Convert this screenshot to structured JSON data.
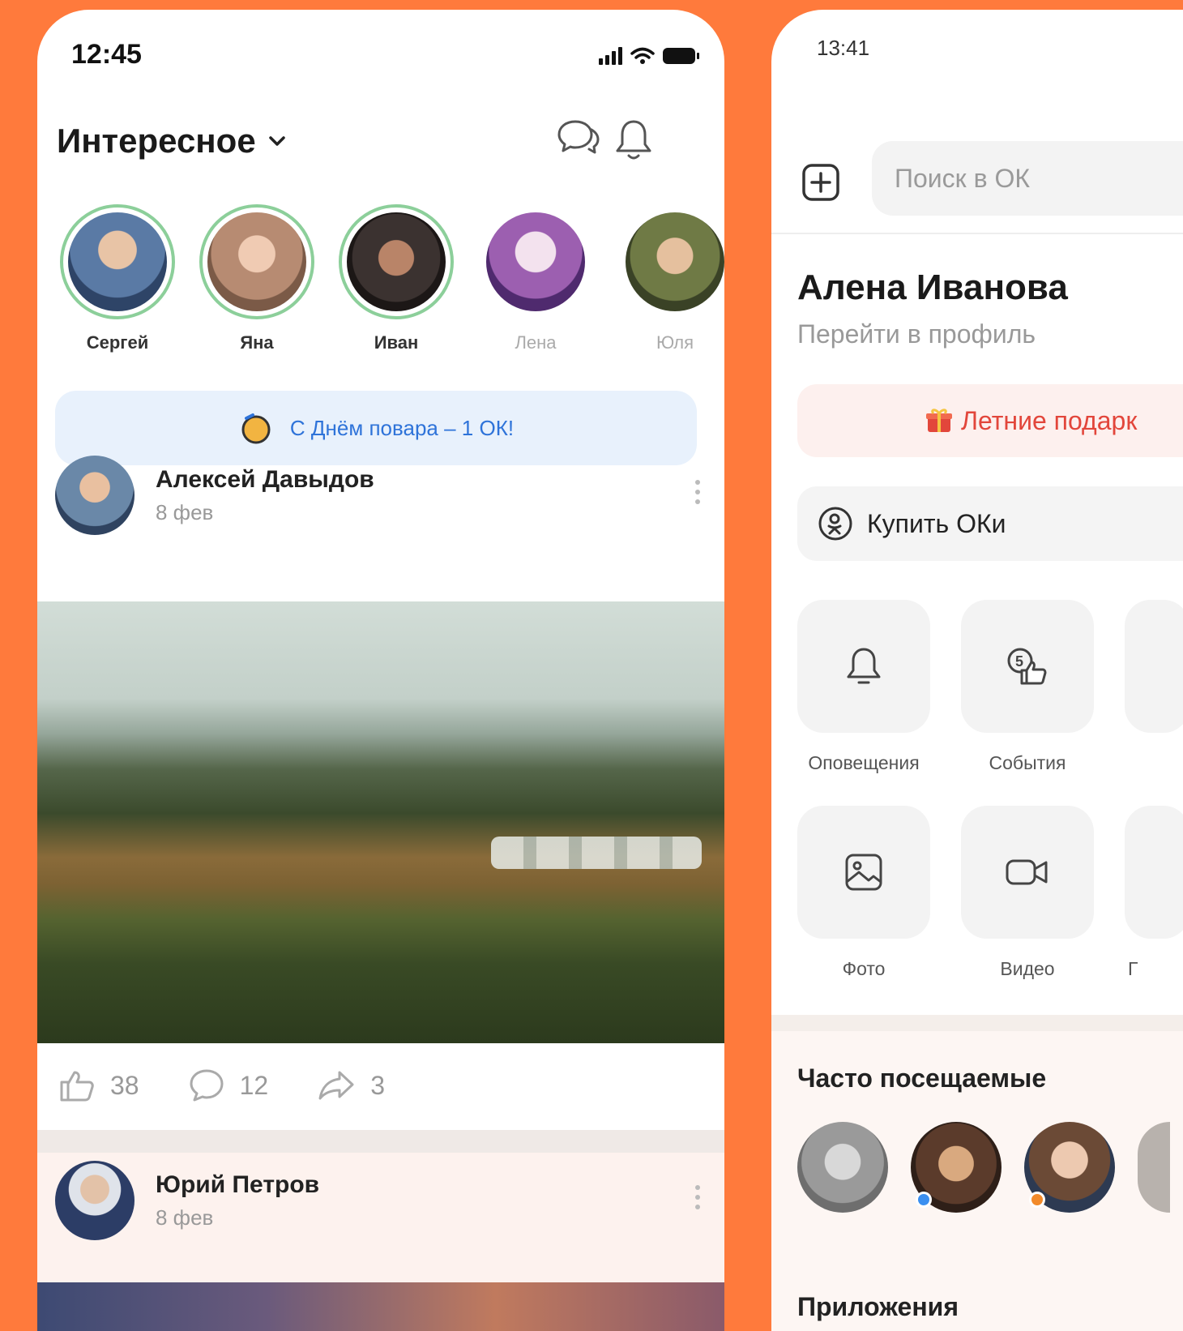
{
  "left_phone": {
    "status_time": "12:45",
    "feed_title": "Интересное",
    "stories": [
      {
        "name": "Сергей",
        "color": "#5a7aa5",
        "ring": true,
        "dim": false
      },
      {
        "name": "Яна",
        "color": "#b78b72",
        "ring": true,
        "dim": false
      },
      {
        "name": "Иван",
        "color": "#3b3230",
        "ring": true,
        "dim": false
      },
      {
        "name": "Лена",
        "color": "#9c5fb0",
        "ring": false,
        "dim": true
      },
      {
        "name": "Юля",
        "color": "#6f7a45",
        "ring": false,
        "dim": true
      }
    ],
    "banner": "С Днём повара – 1 ОК!",
    "posts": [
      {
        "author": "Алексей Давыдов",
        "date": "8 фев"
      },
      {
        "author": "Юрий Петров",
        "date": "8 фев"
      }
    ],
    "actions": {
      "likes": "38",
      "comments": "12",
      "shares": "3"
    }
  },
  "right_phone": {
    "status_time": "13:41",
    "search_placeholder": "Поиск в ОК",
    "profile_name": "Алена Иванова",
    "profile_link": "Перейти в профиль",
    "promo": "Летние подарк",
    "buy": "Купить ОКи",
    "tiles": [
      {
        "label": "Оповещения",
        "icon": "bell-icon"
      },
      {
        "label": "События",
        "icon": "events-like-icon"
      },
      {
        "label": "Фото",
        "icon": "photo-icon"
      },
      {
        "label": "Видео",
        "icon": "video-icon"
      }
    ],
    "partial_label": "Г",
    "frequent_title": "Часто посещаемые",
    "apps_title": "Приложения"
  },
  "colors": {
    "accent": "#ff7a3c",
    "banner_text": "#2e73d9",
    "promo_text": "#e2463b",
    "story_ring": "#8ccf9a"
  }
}
